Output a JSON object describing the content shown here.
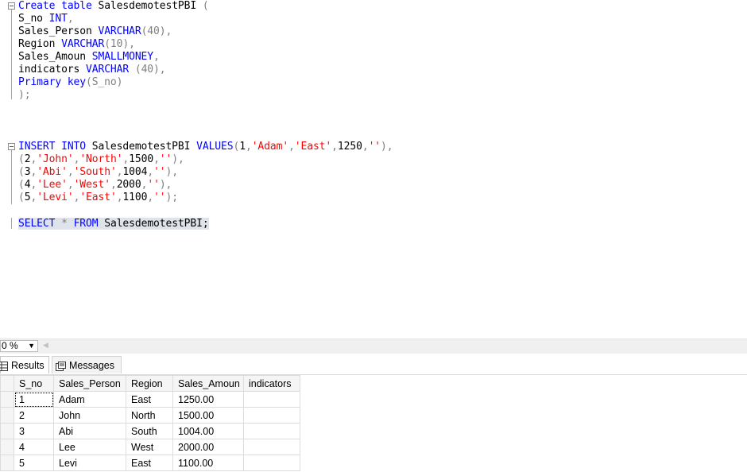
{
  "editor": {
    "create_kw": "Create table",
    "table_name": "SalesdemotestPBI",
    "open_paren": " (",
    "col_sno_name": "S_no",
    "col_sno_type": "INT",
    "col_sp_name": "Sales_Person",
    "col_sp_type": "VARCHAR",
    "col_sp_len": "(40),",
    "col_region_name": "Region",
    "col_region_type": "VARCHAR",
    "col_region_len": "(10),",
    "col_amount_name": "Sales_Amoun",
    "col_amount_type": "SMALLMONEY",
    "col_ind_name": "indicators",
    "col_ind_type": "VARCHAR",
    "col_ind_len": " (40),",
    "pk_kw": "Primary key",
    "pk_col": "(S_no)",
    "close": ");",
    "insert_kw": "INSERT INTO",
    "values_kw": "VALUES",
    "select_kw": "SELECT",
    "star": "*",
    "from_kw": "FROM",
    "select_end": "SalesdemotestPBI;",
    "insert_rows": [
      {
        "num": "1",
        "name": "'Adam'",
        "region": "'East'",
        "amount": "1250",
        "ind": "''",
        "end": "),"
      },
      {
        "num": "2",
        "name": "'John'",
        "region": "'North'",
        "amount": "1500",
        "ind": "''",
        "end": "),"
      },
      {
        "num": "3",
        "name": "'Abi'",
        "region": "'South'",
        "amount": "1004",
        "ind": "''",
        "end": "),"
      },
      {
        "num": "4",
        "name": "'Lee'",
        "region": "'West'",
        "amount": "2000",
        "ind": "''",
        "end": "),"
      },
      {
        "num": "5",
        "name": "'Levi'",
        "region": "'East'",
        "amount": "1100",
        "ind": "''",
        "end": ");"
      }
    ]
  },
  "zoom": {
    "value": "0 %"
  },
  "tabs": {
    "results": "Results",
    "messages": "Messages"
  },
  "results": {
    "columns": [
      "S_no",
      "Sales_Person",
      "Region",
      "Sales_Amoun",
      "indicators"
    ],
    "rows": [
      [
        "1",
        "Adam",
        "East",
        "1250.00",
        ""
      ],
      [
        "2",
        "John",
        "North",
        "1500.00",
        ""
      ],
      [
        "3",
        "Abi",
        "South",
        "1004.00",
        ""
      ],
      [
        "4",
        "Lee",
        "West",
        "2000.00",
        ""
      ],
      [
        "5",
        "Levi",
        "East",
        "1100.00",
        ""
      ]
    ]
  },
  "colors": {
    "keyword": "#0000ff",
    "string": "#ff0000",
    "operator": "#808080",
    "selection": "#dfe3ea"
  }
}
